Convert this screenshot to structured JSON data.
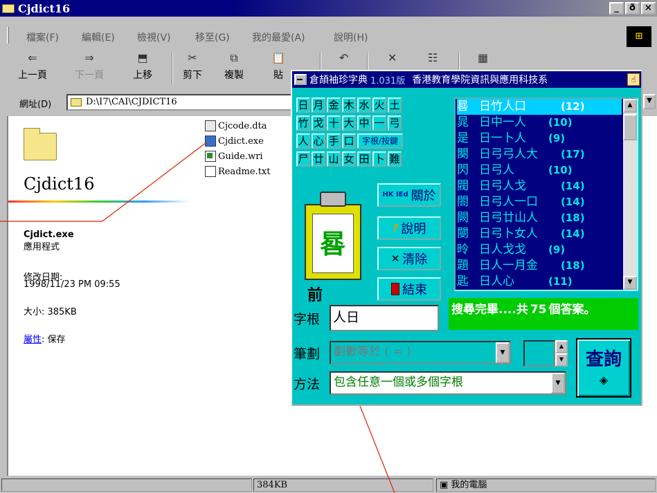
{
  "explorer": {
    "title": "Cjdict16",
    "window_buttons": {
      "minimize": "_",
      "maximize": "ð",
      "close": "×"
    },
    "menus": [
      "檔案(F)",
      "編輯(E)",
      "檢視(V)",
      "移至(G)",
      "我的最愛(A)",
      "說明(H)"
    ],
    "toolbar": {
      "back": "上一頁",
      "forward": "下一頁",
      "up": "上移",
      "cut": "剪下",
      "copy": "複製",
      "paste": "貼"
    },
    "address": {
      "label": "網址(D)",
      "path": "D:\\I7\\CAI\\CJDICT16"
    },
    "folder_name": "Cjdict16",
    "files": [
      "Cjcode.dta",
      "Cjdict.exe",
      "Guide.wri",
      "Readme.txt"
    ],
    "details": {
      "name": "Cjdict.exe",
      "type": "應用程式",
      "modified_label": "修改日期:",
      "modified": "1998/11/23 PM 09:55",
      "size": "大小: 385KB",
      "attr_link": "屬性",
      "attr_value": ": 保存"
    },
    "status": {
      "size": "384KB",
      "location": "我的電腦"
    }
  },
  "cjdict": {
    "title": "倉頡袖珍字典",
    "version": "1.031版",
    "org": "香港教育學院資訊與應用科技系",
    "radicals": [
      [
        "日",
        "月",
        "金",
        "木",
        "水",
        "火",
        "土"
      ],
      [
        "竹",
        "戈",
        "十",
        "大",
        "中",
        "一",
        "弓"
      ],
      [
        "人",
        "心",
        "手",
        "口",
        "字根/按鍵"
      ],
      [
        "尸",
        "廿",
        "山",
        "女",
        "田",
        "卜",
        "難"
      ]
    ],
    "preview_char": "晷",
    "preview_label": "前",
    "buttons": {
      "about_icon": "HK IEd",
      "about": "關於",
      "help_icon": "?",
      "help": "說明",
      "clear_icon": "✕",
      "clear": "清除",
      "exit": "結束"
    },
    "results": [
      {
        "ch": "晷",
        "code": "日竹人口",
        "n": "(12)"
      },
      {
        "ch": "晁",
        "code": "日中一人",
        "n": "(10)"
      },
      {
        "ch": "是",
        "code": "日一卜人",
        "n": "(9)"
      },
      {
        "ch": "闋",
        "code": "日弓弓人大",
        "n": "(17)"
      },
      {
        "ch": "閃",
        "code": "日弓人",
        "n": "(10)"
      },
      {
        "ch": "閥",
        "code": "日弓人戈",
        "n": "(14)"
      },
      {
        "ch": "閤",
        "code": "日弓人一口",
        "n": "(14)"
      },
      {
        "ch": "闕",
        "code": "日弓廿山人",
        "n": "(18)"
      },
      {
        "ch": "閿",
        "code": "日弓卜女人",
        "n": "(14)"
      },
      {
        "ch": "昤",
        "code": "日人戈戈",
        "n": "(9)"
      },
      {
        "ch": "題",
        "code": "日人一月金",
        "n": "(18)"
      },
      {
        "ch": "匙",
        "code": "日人心",
        "n": "(11)"
      }
    ],
    "status_msg": "搜尋完畢....共",
    "status_count": "75",
    "status_suffix": "個答案。",
    "root_label": "字根",
    "root_value": "人日",
    "stroke_label": "筆劃",
    "stroke_placeholder": "劃數等於 ( = )",
    "method_label": "方法",
    "method_value": "包含任意一個或多個字根",
    "query": "查詢"
  }
}
